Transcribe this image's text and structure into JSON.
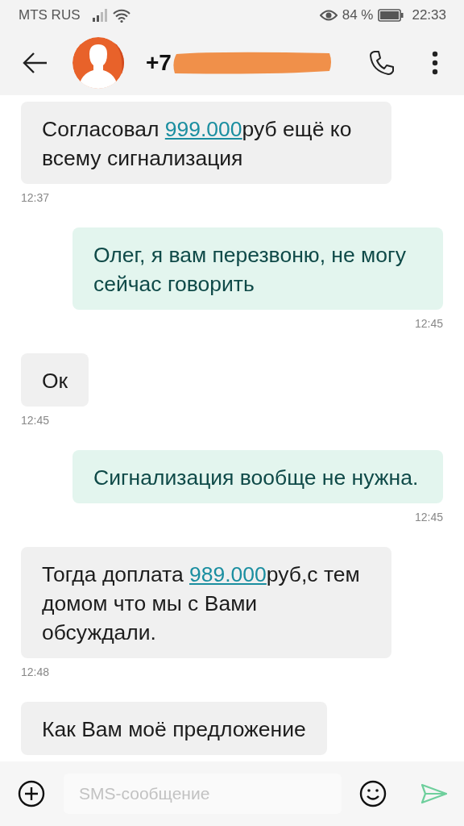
{
  "status_bar": {
    "carrier": "MTS RUS",
    "battery": "84 %",
    "time": "22:33"
  },
  "header": {
    "title": "+7"
  },
  "messages": [
    {
      "kind": "incoming",
      "parts": [
        {
          "kind": "text",
          "text": "Согласовал "
        },
        {
          "kind": "link",
          "text": "999.000"
        },
        {
          "kind": "text",
          "text": "руб ещё ко всему сигнализация"
        }
      ],
      "time": "12:37"
    },
    {
      "kind": "outgoing",
      "parts": [
        {
          "kind": "text",
          "text": "Олег, я вам перезвоню, не могу сейчас говорить"
        }
      ],
      "time": "12:45"
    },
    {
      "kind": "incoming",
      "parts": [
        {
          "kind": "text",
          "text": "Ок"
        }
      ],
      "time": "12:45"
    },
    {
      "kind": "outgoing",
      "parts": [
        {
          "kind": "text",
          "text": "Сигнализация вообще не нужна."
        }
      ],
      "time": "12:45"
    },
    {
      "kind": "incoming",
      "parts": [
        {
          "kind": "text",
          "text": "Тогда доплата "
        },
        {
          "kind": "link",
          "text": "989.000"
        },
        {
          "kind": "text",
          "text": "руб,с тем домом что мы с Вами обсуждали."
        }
      ],
      "time": "12:48"
    },
    {
      "kind": "incoming",
      "parts": [
        {
          "kind": "text",
          "text": "Как Вам моё предложение"
        }
      ]
    }
  ],
  "compose": {
    "placeholder": "SMS-сообщение"
  }
}
